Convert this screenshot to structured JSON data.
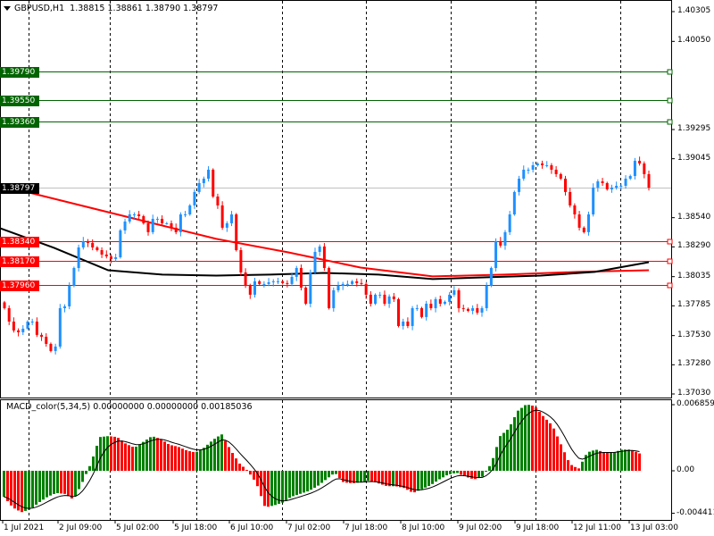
{
  "header": {
    "symbol": "GBPUSD,H1",
    "open": "1.38815",
    "high": "1.38861",
    "low": "1.38790",
    "close": "1.38797"
  },
  "indicator": {
    "label": "MACD_color(5,34,5) 0.00000000 0.00000000 0.00185036",
    "axis_labels": [
      "0.0068593",
      "0.00",
      "-0.004411"
    ]
  },
  "colors": {
    "bull": "#1E90FF",
    "bear": "#FF0000",
    "ma_red": "#FF0000",
    "ma_black": "#000000",
    "hist_up": "#008000",
    "hist_down": "#FF0000",
    "level_green": "#006400",
    "level_red": "#FF0000",
    "current": "#000000"
  },
  "chart_data": [
    {
      "type": "candlestick",
      "title": "GBPUSD,H1",
      "ylim": [
        1.3703,
        1.40305
      ],
      "y_ticks": [
        "1.40305",
        "1.40050",
        "1.39295",
        "1.39045",
        "1.38540",
        "1.38290",
        "1.38035",
        "1.37785",
        "1.37530",
        "1.37280",
        "1.37030"
      ],
      "x_ticks": [
        "1 Jul 2021",
        "2 Jul 09:00",
        "5 Jul 02:00",
        "5 Jul 18:00",
        "6 Jul 10:00",
        "7 Jul 02:00",
        "7 Jul 18:00",
        "8 Jul 10:00",
        "9 Jul 02:00",
        "9 Jul 18:00",
        "12 Jul 11:00",
        "13 Jul 03:00"
      ],
      "closes": [
        1.37765,
        1.3765,
        1.37574,
        1.37559,
        1.37589,
        1.3765,
        1.3765,
        1.37536,
        1.3752,
        1.37459,
        1.37398,
        1.37436,
        1.37765,
        1.3778,
        1.37956,
        1.38109,
        1.38285,
        1.38339,
        1.38324,
        1.38285,
        1.38262,
        1.38224,
        1.38209,
        1.38186,
        1.38201,
        1.38431,
        1.38507,
        1.38568,
        1.38568,
        1.38553,
        1.38492,
        1.38416,
        1.3853,
        1.3853,
        1.38492,
        1.38492,
        1.38454,
        1.38416,
        1.38568,
        1.38568,
        1.38645,
        1.3876,
        1.38836,
        1.38874,
        1.38951,
        1.38721,
        1.38645,
        1.38454,
        1.38492,
        1.38568,
        1.38262,
        1.38071,
        1.37956,
        1.3788,
        1.37995,
        1.37972,
        1.37972,
        1.37987,
        1.37995,
        1.37995,
        1.3798,
        1.37972,
        1.38033,
        1.38109,
        1.37941,
        1.37803,
        1.38071,
        1.38247,
        1.38293,
        1.38109,
        1.37765,
        1.37918,
        1.37956,
        1.37972,
        1.37972,
        1.37995,
        1.3798,
        1.37972,
        1.3788,
        1.37803,
        1.3788,
        1.3788,
        1.37803,
        1.37865,
        1.37842,
        1.37612,
        1.3765,
        1.37612,
        1.37765,
        1.37765,
        1.37689,
        1.37803,
        1.37765,
        1.37842,
        1.37803,
        1.37819,
        1.3788,
        1.37918,
        1.37765,
        1.37758,
        1.37742,
        1.37765,
        1.37727,
        1.37765,
        1.37956,
        1.38109,
        1.38339,
        1.38301,
        1.38416,
        1.38568,
        1.3876,
        1.38874,
        1.38951,
        1.38951,
        1.38989,
        1.39004,
        1.38989,
        1.38989,
        1.38951,
        1.38913,
        1.38874,
        1.3876,
        1.38645,
        1.38568,
        1.38454,
        1.38416,
        1.38568,
        1.38798,
        1.38851,
        1.38836,
        1.38783,
        1.38798,
        1.38813,
        1.38813,
        1.38874,
        1.38897,
        1.39027,
        1.39004,
        1.38913,
        1.38797
      ],
      "ma_red": [
        1.38817,
        1.38664,
        1.38511,
        1.38358,
        1.38243,
        1.38113,
        1.38037,
        1.38052,
        1.38075,
        1.3809
      ],
      "ma_black": [
        1.3845,
        1.38282,
        1.3809,
        1.38052,
        1.38044,
        1.38052,
        1.38067,
        1.38052,
        1.38014,
        1.38029,
        1.38044,
        1.38075,
        1.38159
      ],
      "levels": [
        {
          "value": "1.39790",
          "color": "green"
        },
        {
          "value": "1.39550",
          "color": "green"
        },
        {
          "value": "1.39360",
          "color": "green"
        },
        {
          "value": "1.38340",
          "color": "red"
        },
        {
          "value": "1.38170",
          "color": "red"
        },
        {
          "value": "1.37960",
          "color": "red"
        }
      ],
      "current_price": "1.38797"
    },
    {
      "type": "bar",
      "title": "MACD_color(5,34,5)",
      "unit": "0.001",
      "ylim": [
        -4.411,
        6.8593
      ],
      "histogram": [
        -2.7,
        -3.8,
        -4.3,
        -4.0,
        -3.3,
        -2.7,
        -2.3,
        -2.4,
        -3.0,
        -1.2,
        0.8,
        3.5,
        3.6,
        3.5,
        2.8,
        2.4,
        3.0,
        3.6,
        3.3,
        2.7,
        2.5,
        2.1,
        1.9,
        2.4,
        3.2,
        3.8,
        2.2,
        0.8,
        0.0,
        -1.3,
        -3.8,
        -3.6,
        -3.3,
        -2.7,
        -2.4,
        -2.1,
        -1.6,
        -0.9,
        -0.2,
        -1.2,
        -1.3,
        -1.2,
        -1.0,
        -1.3,
        -1.6,
        -1.6,
        -1.8,
        -2.3,
        -1.9,
        -1.5,
        -0.9,
        -0.4,
        -0.2,
        -0.6,
        -0.9,
        -0.6,
        0.8,
        3.6,
        4.4,
        6.2,
        6.9,
        6.7,
        5.6,
        4.7,
        2.7,
        0.7,
        0.2,
        1.9,
        2.2,
        1.9,
        1.9,
        2.2,
        2.2,
        1.8
      ]
    }
  ]
}
